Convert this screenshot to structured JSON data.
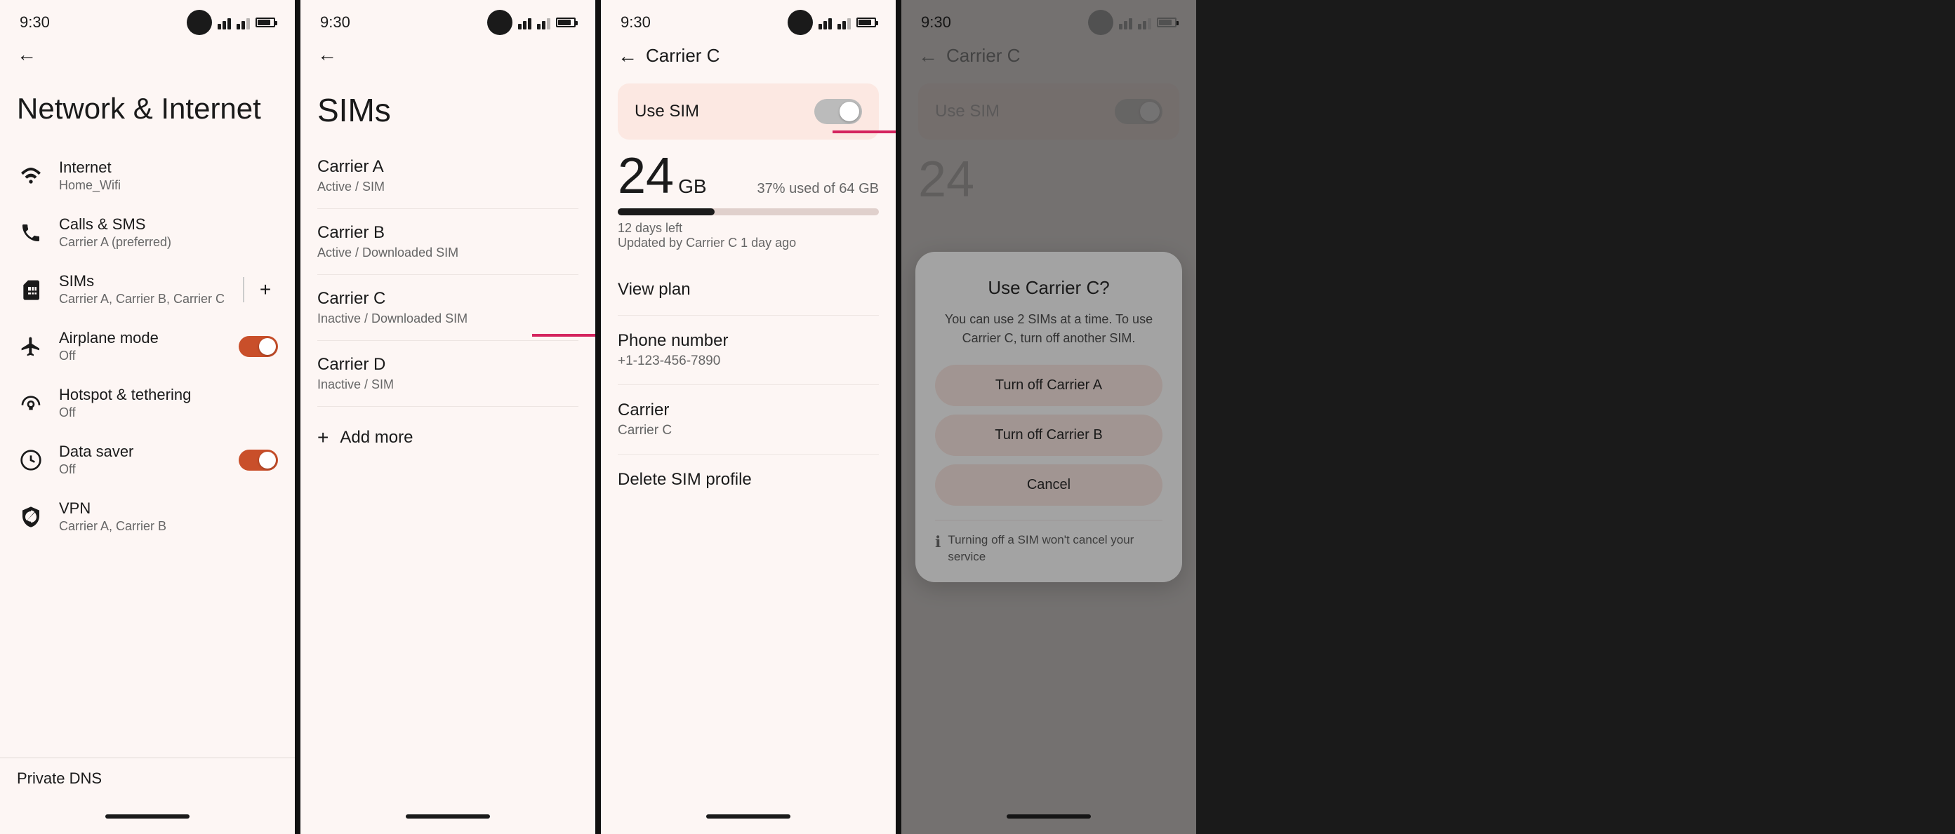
{
  "screen1": {
    "time": "9:30",
    "title": "Network & Internet",
    "back": "←",
    "menu": [
      {
        "id": "internet",
        "icon": "wifi",
        "label": "Internet",
        "sub": "Home_Wifi"
      },
      {
        "id": "calls-sms",
        "icon": "phone",
        "label": "Calls & SMS",
        "sub": "Carrier A (preferred)"
      },
      {
        "id": "sims",
        "icon": "sim",
        "label": "SIMs",
        "sub": "Carrier A, Carrier B, Carrier C"
      },
      {
        "id": "airplane",
        "icon": "airplane",
        "label": "Airplane mode",
        "sub": "Off",
        "toggle": "on"
      },
      {
        "id": "hotspot",
        "icon": "hotspot",
        "label": "Hotspot & tethering",
        "sub": "Off"
      },
      {
        "id": "datasaver",
        "icon": "datasaver",
        "label": "Data saver",
        "sub": "Off",
        "toggle": "on"
      },
      {
        "id": "vpn",
        "icon": "vpn",
        "label": "VPN",
        "sub": "Carrier A, Carrier B"
      }
    ],
    "private_dns": "Private DNS"
  },
  "screen2": {
    "time": "9:30",
    "title": "SIMs",
    "carriers": [
      {
        "name": "Carrier A",
        "status": "Active / SIM"
      },
      {
        "name": "Carrier B",
        "status": "Active / Downloaded SIM"
      },
      {
        "name": "Carrier C",
        "status": "Inactive / Downloaded SIM"
      },
      {
        "name": "Carrier D",
        "status": "Inactive / SIM"
      }
    ],
    "add_more": "Add more"
  },
  "screen3": {
    "time": "9:30",
    "back": "←",
    "title": "Carrier C",
    "use_sim_label": "Use SIM",
    "data_number": "24",
    "data_unit": "GB",
    "data_percent": "37% used of 64 GB",
    "days_left": "12 days left",
    "updated": "Updated by Carrier C 1 day ago",
    "progress": 37,
    "items": [
      {
        "id": "view-plan",
        "label": "View plan",
        "sub": ""
      },
      {
        "id": "phone-number",
        "label": "Phone number",
        "sub": "+1-123-456-7890"
      },
      {
        "id": "carrier",
        "label": "Carrier",
        "sub": "Carrier C"
      },
      {
        "id": "delete",
        "label": "Delete SIM profile",
        "sub": ""
      }
    ]
  },
  "screen4": {
    "time": "9:30",
    "back": "←",
    "title": "Carrier C",
    "use_sim_label": "Use SIM",
    "data_number": "24",
    "dialog": {
      "title": "Use Carrier C?",
      "desc": "You can use 2 SIMs at a time. To use Carrier C, turn off another SIM.",
      "btn1": "Turn off Carrier A",
      "btn2": "Turn off Carrier B",
      "btn3": "Cancel",
      "note": "Turning off a SIM won't cancel your service"
    }
  },
  "colors": {
    "accent": "#c94f2a",
    "arrow": "#d4245e",
    "bg": "#fdf6f4",
    "toggle_on": "#c94f2a",
    "dialog_btn_bg": "#fce8e2"
  }
}
